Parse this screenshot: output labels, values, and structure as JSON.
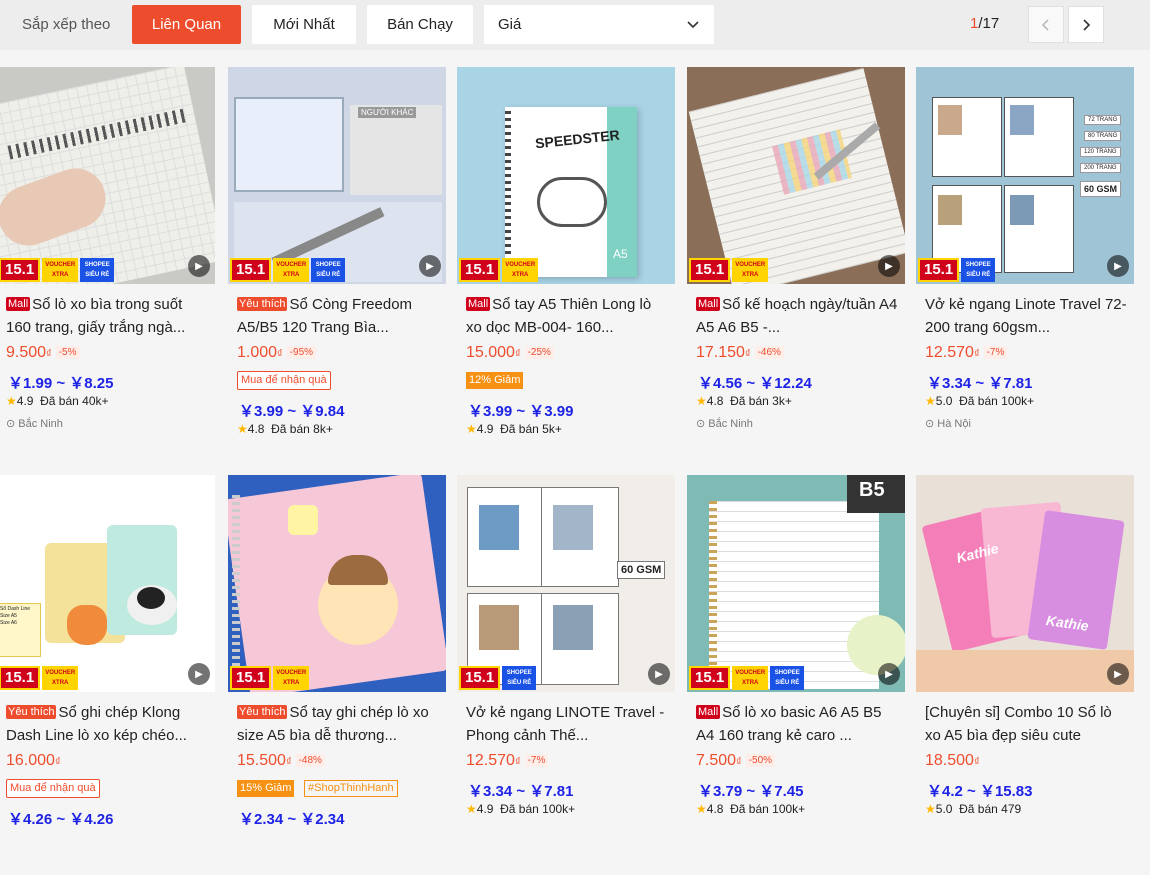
{
  "sortbar": {
    "label": "Sắp xếp theo",
    "buttons": [
      "Liên Quan",
      "Mới Nhất",
      "Bán Chạy"
    ],
    "price_label": "Giá",
    "page_current": "1",
    "page_total": "/17"
  },
  "colors": {
    "accent": "#ee4d2d",
    "blue_price": "#1e23e6",
    "mall": "#d0011b"
  },
  "products": [
    {
      "badge": "Mall",
      "title": "Sổ lò xo bìa trong suốt 160 trang, giấy trắng ngà...",
      "price": "9.500",
      "currency": "₫",
      "discount": "-5%",
      "yen": "￥1.99 ~ ￥8.25",
      "rating": "4.9",
      "sold": "Đã bán 40k+",
      "location": "Bắc Ninh",
      "promo": ""
    },
    {
      "badge": "Yêu thích",
      "title": "Sổ Còng Freedom A5/B5 120 Trang Bìa...",
      "price": "1.000",
      "currency": "₫",
      "discount": "-95%",
      "yen": "￥3.99 ~ ￥9.84",
      "rating": "4.8",
      "sold": "Đã bán 8k+",
      "location": "",
      "promo": "Mua để nhận quà"
    },
    {
      "badge": "Mall",
      "title": "Sổ tay A5 Thiên Long lò xo dọc MB-004- 160...",
      "price": "15.000",
      "currency": "₫",
      "discount": "-25%",
      "yen": "￥3.99 ~ ￥3.99",
      "rating": "4.9",
      "sold": "Đã bán 5k+",
      "location": "",
      "promo": "12% Giảm"
    },
    {
      "badge": "Mall",
      "title": "Sổ kế hoạch ngày/tuần A4 A5 A6 B5 -...",
      "price": "17.150",
      "currency": "₫",
      "discount": "-46%",
      "yen": "￥4.56 ~ ￥12.24",
      "rating": "4.8",
      "sold": "Đã bán 3k+",
      "location": "Bắc Ninh",
      "promo": ""
    },
    {
      "badge": "",
      "title": "Vở kẻ ngang Linote Travel 72-200 trang 60gsm...",
      "price": "12.570",
      "currency": "₫",
      "discount": "-7%",
      "yen": "￥3.34 ~ ￥7.81",
      "rating": "5.0",
      "sold": "Đã bán 100k+",
      "location": "Hà Nội",
      "promo": ""
    },
    {
      "badge": "Yêu thích",
      "title": "Sổ ghi chép Klong Dash Line lò xo kép chéo...",
      "price": "16.000",
      "currency": "₫",
      "discount": "",
      "yen": "￥4.26 ~ ￥4.26",
      "rating": "",
      "sold": "",
      "location": "",
      "promo": "Mua để nhận quà"
    },
    {
      "badge": "Yêu thích",
      "title": "Sổ tay ghi chép lò xo size A5 bìa dễ thương...",
      "price": "15.500",
      "currency": "₫",
      "discount": "-48%",
      "yen": "￥2.34 ~ ￥2.34",
      "rating": "",
      "sold": "",
      "location": "",
      "promo": "15% Giảm",
      "promo_b": "#ShopThinhHanh"
    },
    {
      "badge": "",
      "title": "Vở kẻ ngang LINOTE Travel - Phong cảnh Thế...",
      "price": "12.570",
      "currency": "₫",
      "discount": "-7%",
      "yen": "￥3.34 ~ ￥7.81",
      "rating": "4.9",
      "sold": "Đã bán 100k+",
      "location": "",
      "promo": ""
    },
    {
      "badge": "Mall",
      "title": "Sổ lò xo basic A6 A5 B5 A4 160 trang kẻ caro ...",
      "price": "7.500",
      "currency": "₫",
      "discount": "-50%",
      "yen": "￥3.79 ~ ￥7.45",
      "rating": "4.8",
      "sold": "Đã bán 100k+",
      "location": "",
      "promo": ""
    },
    {
      "badge": "",
      "title": "[Chuyên sỉ] Combo 10 Sổ lò xo A5 bìa đẹp siêu cute",
      "price": "18.500",
      "currency": "₫",
      "discount": "",
      "yen": "￥4.2 ~ ￥15.83",
      "rating": "5.0",
      "sold": "Đã bán 479",
      "location": "",
      "promo": ""
    }
  ],
  "ribbons": {
    "sale": "15.1",
    "voucher": "VOUCHER XTRA",
    "shopee": "SHOPEE SIÊU RẺ"
  },
  "image_text": {
    "speedster": "SPEEDSTER",
    "size_a5": "A5",
    "b5": "B5",
    "gsm60": "60 GSM",
    "kathie": "Kathie",
    "trang_72": "72 TRANG",
    "trang_80": "80 TRANG",
    "trang_120": "120 TRANG",
    "trang_200": "200 TRANG"
  }
}
